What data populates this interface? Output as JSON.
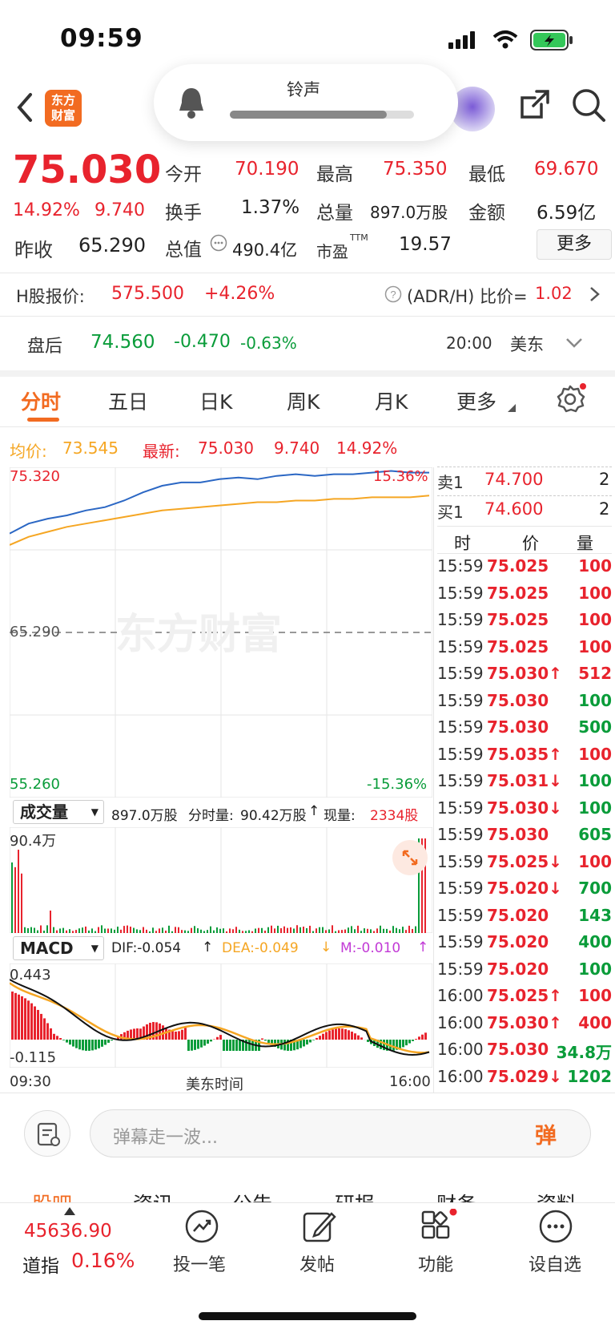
{
  "status_bar": {
    "time": "09:59"
  },
  "toast": {
    "label": "铃声",
    "level": 0.85
  },
  "quote": {
    "price": "75.030",
    "pct": "14.92%",
    "chg": "9.740",
    "prev_close_label": "昨收",
    "prev_close": "65.290",
    "open_label": "今开",
    "open": "70.190",
    "high_label": "最高",
    "high": "75.350",
    "low_label": "最低",
    "low": "69.670",
    "turnover_label": "换手",
    "turnover": "1.37%",
    "volume_label": "总量",
    "volume": "897.0万股",
    "amount_label": "金额",
    "amount": "6.59亿",
    "mktcap_label": "总值",
    "mktcap": "490.4亿",
    "pe_label": "市盈",
    "pe_sup": "TTM",
    "pe": "19.57",
    "more_button": "更多"
  },
  "h_share": {
    "label": "H股报价:",
    "price": "575.500",
    "chg": "+4.26%",
    "ratio_label": "(ADR/H) 比价=",
    "ratio": "1.02"
  },
  "after_hours": {
    "label": "盘后",
    "price": "74.560",
    "chg": "-0.470",
    "pct": "-0.63%",
    "time": "20:00",
    "market": "美东"
  },
  "tabs": [
    "分时",
    "五日",
    "日K",
    "周K",
    "月K",
    "更多"
  ],
  "chart_info": {
    "avg_label": "均价:",
    "avg": "73.545",
    "last_label": "最新:",
    "last": "75.030",
    "chg": "9.740",
    "pct": "14.92%"
  },
  "chart_data": {
    "type": "line",
    "y_top": "75.320",
    "y_mid": "65.290",
    "y_bottom": "55.260",
    "pct_top": "15.36%",
    "pct_bottom": "-15.36%",
    "ylim": [
      55.26,
      75.32
    ],
    "series": [
      {
        "values": [
          71.3,
          71.9,
          72.2,
          72.4,
          72.7,
          72.9,
          73.3,
          73.8,
          74.2,
          74.4,
          74.4,
          74.6,
          74.7,
          74.6,
          74.8,
          74.9,
          74.8,
          74.9,
          74.9,
          75.0,
          75.1,
          75.0,
          75.0
        ],
        "color": "#2b67c4"
      },
      {
        "values": [
          70.6,
          71.1,
          71.4,
          71.7,
          71.9,
          72.1,
          72.3,
          72.5,
          72.7,
          72.8,
          72.9,
          73.0,
          73.1,
          73.2,
          73.2,
          73.3,
          73.3,
          73.4,
          73.4,
          73.5,
          73.5,
          73.5,
          73.6
        ],
        "color": "#f5a623"
      }
    ],
    "x_start": "09:30",
    "x_mid": "美东时间",
    "x_end": "16:00"
  },
  "volume_panel": {
    "selector": "成交量",
    "total": "897.0万股",
    "interval_label": "分时量:",
    "interval": "90.42万股",
    "current_label": "现量:",
    "current": "2334股",
    "max": "90.4万"
  },
  "macd_panel": {
    "selector": "MACD",
    "dif": "DIF:-0.054",
    "dea": "DEA:-0.049",
    "m": "M:-0.010",
    "top": "0.443",
    "bottom": "-0.115"
  },
  "order_book": {
    "sell1_label": "卖1",
    "sell1_price": "74.700",
    "sell1_qty": "2",
    "buy1_label": "买1",
    "buy1_price": "74.600",
    "buy1_qty": "2",
    "headers": [
      "时",
      "价",
      "量"
    ],
    "rows": [
      {
        "t": "15:59",
        "p": "75.025",
        "q": "100",
        "d": "",
        "c": "red"
      },
      {
        "t": "15:59",
        "p": "75.025",
        "q": "100",
        "d": "",
        "c": "red"
      },
      {
        "t": "15:59",
        "p": "75.025",
        "q": "100",
        "d": "",
        "c": "red"
      },
      {
        "t": "15:59",
        "p": "75.025",
        "q": "100",
        "d": "",
        "c": "red"
      },
      {
        "t": "15:59",
        "p": "75.030",
        "q": "512",
        "d": "↑",
        "c": "red"
      },
      {
        "t": "15:59",
        "p": "75.030",
        "q": "100",
        "d": "",
        "c": "green"
      },
      {
        "t": "15:59",
        "p": "75.030",
        "q": "500",
        "d": "",
        "c": "green"
      },
      {
        "t": "15:59",
        "p": "75.035",
        "q": "100",
        "d": "↑",
        "c": "red"
      },
      {
        "t": "15:59",
        "p": "75.031",
        "q": "100",
        "d": "↓",
        "c": "green"
      },
      {
        "t": "15:59",
        "p": "75.030",
        "q": "100",
        "d": "↓",
        "c": "green"
      },
      {
        "t": "15:59",
        "p": "75.030",
        "q": "605",
        "d": "",
        "c": "green"
      },
      {
        "t": "15:59",
        "p": "75.025",
        "q": "100",
        "d": "↓",
        "c": "red"
      },
      {
        "t": "15:59",
        "p": "75.020",
        "q": "700",
        "d": "↓",
        "c": "green"
      },
      {
        "t": "15:59",
        "p": "75.020",
        "q": "143",
        "d": "",
        "c": "green"
      },
      {
        "t": "15:59",
        "p": "75.020",
        "q": "400",
        "d": "",
        "c": "green"
      },
      {
        "t": "15:59",
        "p": "75.020",
        "q": "100",
        "d": "",
        "c": "green"
      },
      {
        "t": "16:00",
        "p": "75.025",
        "q": "100",
        "d": "↑",
        "c": "red"
      },
      {
        "t": "16:00",
        "p": "75.030",
        "q": "400",
        "d": "↑",
        "c": "red"
      },
      {
        "t": "16:00",
        "p": "75.030",
        "q": "34.8万",
        "d": "",
        "c": "green"
      },
      {
        "t": "16:00",
        "p": "75.029",
        "q": "1202",
        "d": "↓",
        "c": "green"
      }
    ]
  },
  "danmaku": {
    "placeholder": "弹幕走一波...",
    "button": "弹"
  },
  "lower_tabs": [
    "股吧",
    "资讯",
    "公告",
    "研报",
    "财务",
    "资料"
  ],
  "index": {
    "value": "45636.90",
    "name": "道指",
    "pct": "0.16%"
  },
  "bottom_nav": [
    "投一笔",
    "发帖",
    "功能",
    "设自选"
  ],
  "watermark": "东方财富",
  "logo_text": "东方财富"
}
